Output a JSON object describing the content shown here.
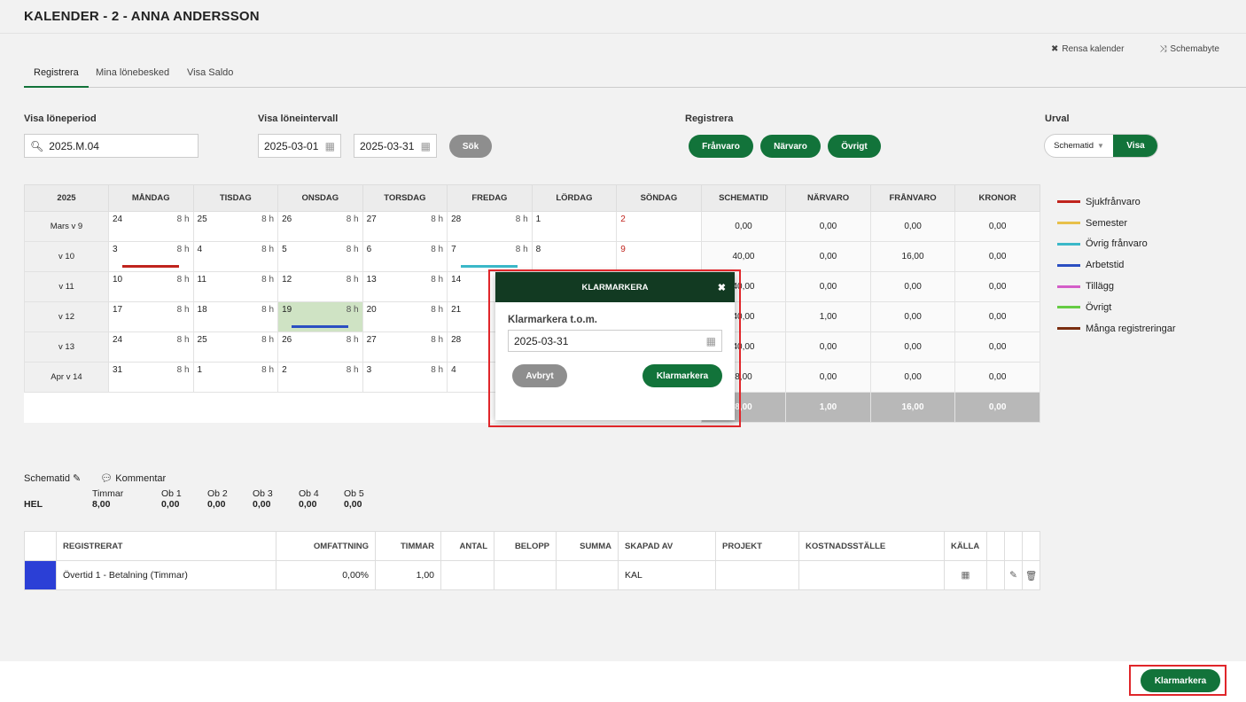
{
  "title": "KALENDER - 2 - ANNA ANDERSSON",
  "tools": {
    "clear": "Rensa kalender",
    "swap": "Schemabyte"
  },
  "tabs": [
    "Registrera",
    "Mina lönebesked",
    "Visa Saldo"
  ],
  "filters": {
    "period_label": "Visa löneperiod",
    "period_value": "2025.M.04",
    "interval_label": "Visa löneintervall",
    "from": "2025-03-01",
    "to": "2025-03-31",
    "search": "Sök",
    "register_label": "Registrera",
    "frånvaro": "Frånvaro",
    "närvaro": "Närvaro",
    "övrigt": "Övrigt",
    "urval_label": "Urval",
    "urval_select": "Schematid",
    "visa": "Visa"
  },
  "calendar": {
    "headers": [
      "2025",
      "MÅNDAG",
      "TISDAG",
      "ONSDAG",
      "TORSDAG",
      "FREDAG",
      "LÖRDAG",
      "SÖNDAG",
      "SCHEMATID",
      "NÄRVARO",
      "FRÅNVARO",
      "KRONOR"
    ],
    "rows": [
      {
        "week": "Mars v 9",
        "days": [
          [
            "24",
            "8 h"
          ],
          [
            "25",
            "8 h"
          ],
          [
            "26",
            "8 h"
          ],
          [
            "27",
            "8 h"
          ],
          [
            "28",
            "8 h"
          ],
          [
            "1",
            ""
          ],
          [
            "2",
            ""
          ]
        ],
        "sums": [
          "0,00",
          "0,00",
          "0,00",
          "0,00"
        ]
      },
      {
        "week": "v 10",
        "days": [
          [
            "3",
            "8 h"
          ],
          [
            "4",
            "8 h"
          ],
          [
            "5",
            "8 h"
          ],
          [
            "6",
            "8 h"
          ],
          [
            "7",
            "8 h"
          ],
          [
            "8",
            ""
          ],
          [
            "9",
            ""
          ]
        ],
        "sums": [
          "40,00",
          "0,00",
          "16,00",
          "0,00"
        ]
      },
      {
        "week": "v 11",
        "days": [
          [
            "10",
            "8 h"
          ],
          [
            "11",
            "8 h"
          ],
          [
            "12",
            "8 h"
          ],
          [
            "13",
            "8 h"
          ],
          [
            "14",
            ""
          ],
          [
            "",
            ""
          ],
          [
            "",
            ""
          ]
        ],
        "sums": [
          "40,00",
          "0,00",
          "0,00",
          "0,00"
        ]
      },
      {
        "week": "v 12",
        "days": [
          [
            "17",
            "8 h"
          ],
          [
            "18",
            "8 h"
          ],
          [
            "19",
            "8 h"
          ],
          [
            "20",
            "8 h"
          ],
          [
            "21",
            ""
          ],
          [
            "",
            ""
          ],
          [
            "",
            ""
          ]
        ],
        "sums": [
          "40,00",
          "1,00",
          "0,00",
          "0,00"
        ]
      },
      {
        "week": "v 13",
        "days": [
          [
            "24",
            "8 h"
          ],
          [
            "25",
            "8 h"
          ],
          [
            "26",
            "8 h"
          ],
          [
            "27",
            "8 h"
          ],
          [
            "28",
            ""
          ],
          [
            "",
            ""
          ],
          [
            "",
            ""
          ]
        ],
        "sums": [
          "40,00",
          "0,00",
          "0,00",
          "0,00"
        ]
      },
      {
        "week": "Apr v 14",
        "days": [
          [
            "31",
            "8 h"
          ],
          [
            "1",
            "8 h"
          ],
          [
            "2",
            "8 h"
          ],
          [
            "3",
            "8 h"
          ],
          [
            "4",
            ""
          ],
          [
            "",
            ""
          ],
          [
            "",
            ""
          ]
        ],
        "sums": [
          "8,00",
          "0,00",
          "0,00",
          "0,00"
        ]
      }
    ],
    "totals": [
      "8,00",
      "1,00",
      "16,00",
      "0,00"
    ]
  },
  "legend": [
    {
      "label": "Sjukfrånvaro",
      "color": "#c0241d"
    },
    {
      "label": "Semester",
      "color": "#e8c04a"
    },
    {
      "label": "Övrig frånvaro",
      "color": "#3bb8c8"
    },
    {
      "label": "Arbetstid",
      "color": "#2b4fc2"
    },
    {
      "label": "Tillägg",
      "color": "#d45ec8"
    },
    {
      "label": "Övrigt",
      "color": "#66cc44"
    },
    {
      "label": "Många registreringar",
      "color": "#7a2e10"
    }
  ],
  "schedule": {
    "schematid": "Schematid",
    "kommentar": "Kommentar",
    "row_label": "HEL",
    "cols": [
      [
        "Timmar",
        "8,00"
      ],
      [
        "Ob 1",
        "0,00"
      ],
      [
        "Ob 2",
        "0,00"
      ],
      [
        "Ob 3",
        "0,00"
      ],
      [
        "Ob 4",
        "0,00"
      ],
      [
        "Ob 5",
        "0,00"
      ]
    ]
  },
  "grid": {
    "headers": [
      "REGISTRERAT",
      "OMFATTNING",
      "TIMMAR",
      "ANTAL",
      "BELOPP",
      "SUMMA",
      "SKAPAD AV",
      "PROJEKT",
      "KOSTNADSSTÄLLE",
      "KÄLLA"
    ],
    "row": [
      "Övertid 1 - Betalning (Timmar)",
      "0,00%",
      "1,00",
      "",
      "",
      "",
      "KAL",
      "",
      "",
      ""
    ]
  },
  "modal": {
    "title": "KLARMARKERA",
    "field_label": "Klarmarkera t.o.m.",
    "date": "2025-03-31",
    "cancel": "Avbryt",
    "confirm": "Klarmarkera"
  },
  "footer_button": "Klarmarkera"
}
